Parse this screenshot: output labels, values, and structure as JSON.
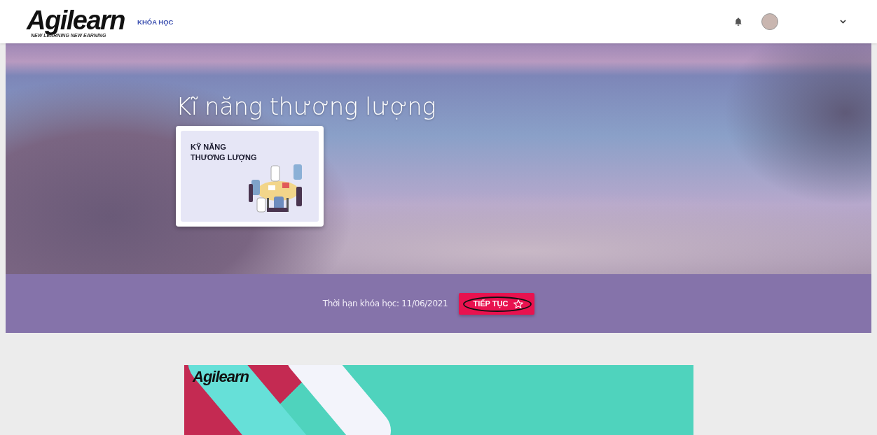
{
  "header": {
    "logo": "Agilearn",
    "logo_tagline": "NEW LEARNING NEW EARNING",
    "nav": [
      "KHÓA HỌC"
    ]
  },
  "course": {
    "title": "Kĩ năng thương lượng",
    "thumbnail_lines": [
      "KỸ NĂNG",
      "THƯƠNG LƯỢNG"
    ]
  },
  "band": {
    "deadline": "Thời hạn khóa học: 11/06/2021",
    "button": "TIẾP TỤC",
    "button_circled": true
  },
  "banner": {
    "logo": "Agilearn"
  }
}
